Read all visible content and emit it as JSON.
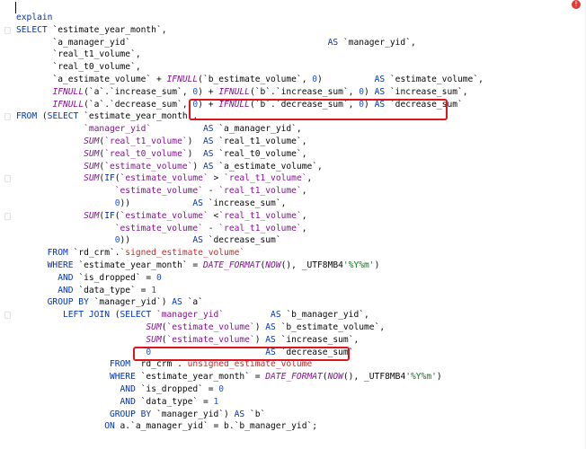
{
  "editor": {
    "status": {
      "warning_glyph": "!"
    },
    "lines": [
      [
        [
          "kw",
          "explain"
        ]
      ],
      [
        [
          "kw",
          "SELECT "
        ],
        [
          "ident",
          "`estimate_year_month`,"
        ]
      ],
      [
        [
          "ident",
          "       `a_manager_yid`                                      "
        ],
        [
          "kw",
          "AS "
        ],
        [
          "ident",
          "`manager_yid`,"
        ]
      ],
      [
        [
          "ident",
          "       `real_t1_volume`,"
        ]
      ],
      [
        [
          "ident",
          "       `real_t0_volume`,"
        ]
      ],
      [
        [
          "ident",
          "       `a_estimate_volume` + "
        ],
        [
          "fn",
          "IFNULL"
        ],
        [
          "ident",
          "(`b_estimate_volume`, "
        ],
        [
          "num",
          "0"
        ],
        [
          "ident",
          ")          "
        ],
        [
          "kw",
          "AS "
        ],
        [
          "ident",
          "`estimate_volume`,"
        ]
      ],
      [
        [
          "ident",
          "       "
        ],
        [
          "fn",
          "IFNULL"
        ],
        [
          "ident",
          "(`a`.`increase_sum`, "
        ],
        [
          "num",
          "0"
        ],
        [
          "ident",
          ") + "
        ],
        [
          "fn",
          "IFNULL"
        ],
        [
          "ident",
          "(`b`.`increase_sum`, "
        ],
        [
          "num",
          "0"
        ],
        [
          "ident",
          ") "
        ],
        [
          "kw",
          "AS "
        ],
        [
          "ident",
          "`increase_sum`,"
        ]
      ],
      [
        [
          "ident",
          "       "
        ],
        [
          "fn",
          "IFNULL"
        ],
        [
          "ident",
          "(`a`.`decrease_sum`, "
        ],
        [
          "num",
          "0"
        ],
        [
          "ident",
          ") + "
        ],
        [
          "fn",
          "IFNULL"
        ],
        [
          "ident",
          "(`b`.`decrease_sum`, "
        ],
        [
          "num",
          "0"
        ],
        [
          "ident",
          ") "
        ],
        [
          "kw",
          "AS "
        ],
        [
          "ident",
          "`decrease_sum`"
        ]
      ],
      [
        [
          "kw",
          "FROM "
        ],
        [
          "ident",
          "("
        ],
        [
          "kw",
          "SELECT "
        ],
        [
          "ident",
          "`estimate_year_month`,"
        ]
      ],
      [
        [
          "ident",
          "             "
        ],
        [
          "col",
          "`manager_yid`"
        ],
        [
          "ident",
          "          "
        ],
        [
          "kw",
          "AS "
        ],
        [
          "ident",
          "`a_manager_yid`,"
        ]
      ],
      [
        [
          "ident",
          "             "
        ],
        [
          "fn",
          "SUM"
        ],
        [
          "ident",
          "("
        ],
        [
          "col",
          "`real_t1_volume`"
        ],
        [
          "ident",
          ")  "
        ],
        [
          "kw",
          "AS "
        ],
        [
          "ident",
          "`real_t1_volume`,"
        ]
      ],
      [
        [
          "ident",
          "             "
        ],
        [
          "fn",
          "SUM"
        ],
        [
          "ident",
          "("
        ],
        [
          "col",
          "`real_t0_volume`"
        ],
        [
          "ident",
          ")  "
        ],
        [
          "kw",
          "AS "
        ],
        [
          "ident",
          "`real_t0_volume`,"
        ]
      ],
      [
        [
          "ident",
          "             "
        ],
        [
          "fn",
          "SUM"
        ],
        [
          "ident",
          "("
        ],
        [
          "col",
          "`estimate_volume`"
        ],
        [
          "ident",
          ") "
        ],
        [
          "kw",
          "AS "
        ],
        [
          "ident",
          "`a_estimate_volume`,"
        ]
      ],
      [
        [
          "ident",
          "             "
        ],
        [
          "fn",
          "SUM"
        ],
        [
          "ident",
          "("
        ],
        [
          "kw",
          "IF"
        ],
        [
          "ident",
          "("
        ],
        [
          "col",
          "`estimate_volume`"
        ],
        [
          "ident",
          " > "
        ],
        [
          "col",
          "`real_t1_volume`"
        ],
        [
          "ident",
          ","
        ]
      ],
      [
        [
          "ident",
          "                   "
        ],
        [
          "col",
          "`estimate_volume`"
        ],
        [
          "ident",
          " - "
        ],
        [
          "col",
          "`real_t1_volume`"
        ],
        [
          "ident",
          ","
        ]
      ],
      [
        [
          "ident",
          "                   "
        ],
        [
          "num",
          "0"
        ],
        [
          "ident",
          "))            "
        ],
        [
          "kw",
          "AS "
        ],
        [
          "ident",
          "`increase_sum`,"
        ]
      ],
      [
        [
          "ident",
          "             "
        ],
        [
          "fn",
          "SUM"
        ],
        [
          "ident",
          "("
        ],
        [
          "kw",
          "IF"
        ],
        [
          "ident",
          "("
        ],
        [
          "col",
          "`estimate_volume`"
        ],
        [
          "ident",
          " <"
        ],
        [
          "col",
          "`real_t1_volume`"
        ],
        [
          "ident",
          ","
        ]
      ],
      [
        [
          "ident",
          "                   "
        ],
        [
          "col",
          "`estimate_volume`"
        ],
        [
          "ident",
          " - "
        ],
        [
          "col",
          "`real_t1_volume`"
        ],
        [
          "ident",
          ","
        ]
      ],
      [
        [
          "ident",
          "                   "
        ],
        [
          "num",
          "0"
        ],
        [
          "ident",
          "))            "
        ],
        [
          "kw",
          "AS "
        ],
        [
          "ident",
          "`decrease_sum`"
        ]
      ],
      [
        [
          "ident",
          "      "
        ],
        [
          "kw",
          "FROM "
        ],
        [
          "ident",
          "`rd_crm`."
        ],
        [
          "red",
          "`signed_estimate_volume`"
        ]
      ],
      [
        [
          "ident",
          "      "
        ],
        [
          "kw",
          "WHERE "
        ],
        [
          "ident",
          "`estimate_year_month` = "
        ],
        [
          "fn",
          "DATE_FORMAT"
        ],
        [
          "ident",
          "("
        ],
        [
          "fn",
          "NOW"
        ],
        [
          "ident",
          "(), _UTF8MB4"
        ],
        [
          "str",
          "'%Y%m'"
        ],
        [
          "ident",
          ")"
        ]
      ],
      [
        [
          "ident",
          "        "
        ],
        [
          "kw",
          "AND "
        ],
        [
          "ident",
          "`is_dropped` = "
        ],
        [
          "num",
          "0"
        ]
      ],
      [
        [
          "ident",
          "        "
        ],
        [
          "kw",
          "AND "
        ],
        [
          "ident",
          "`data_type` = "
        ],
        [
          "num",
          "1"
        ]
      ],
      [
        [
          "ident",
          "      "
        ],
        [
          "kw",
          "GROUP BY "
        ],
        [
          "ident",
          "`manager_yid`) "
        ],
        [
          "kw",
          "AS "
        ],
        [
          "ident",
          "`a`"
        ]
      ],
      [
        [
          "ident",
          "         "
        ],
        [
          "kw",
          "LEFT JOIN "
        ],
        [
          "ident",
          "("
        ],
        [
          "kw",
          "SELECT "
        ],
        [
          "col",
          "`manager_yid`"
        ],
        [
          "ident",
          "         "
        ],
        [
          "kw",
          "AS "
        ],
        [
          "ident",
          "`b_manager_yid`,"
        ]
      ],
      [
        [
          "ident",
          "                         "
        ],
        [
          "fn",
          "SUM"
        ],
        [
          "ident",
          "("
        ],
        [
          "col",
          "`estimate_volume`"
        ],
        [
          "ident",
          ") "
        ],
        [
          "kw",
          "AS "
        ],
        [
          "ident",
          "`b_estimate_volume`,"
        ]
      ],
      [
        [
          "ident",
          "                         "
        ],
        [
          "fn",
          "SUM"
        ],
        [
          "ident",
          "("
        ],
        [
          "col",
          "`estimate_volume`"
        ],
        [
          "ident",
          ") "
        ],
        [
          "kw",
          "AS "
        ],
        [
          "ident",
          "`increase_sum`,"
        ]
      ],
      [
        [
          "ident",
          "                         "
        ],
        [
          "num",
          "0"
        ],
        [
          "ident",
          "                      "
        ],
        [
          "kw",
          "AS "
        ],
        [
          "ident",
          "`decrease_sum`"
        ]
      ],
      [
        [
          "ident",
          "                  "
        ],
        [
          "kw",
          "FROM "
        ],
        [
          "ident",
          "`rd_crm`."
        ],
        [
          "red",
          "`unsigned_estimate_volume`"
        ]
      ],
      [
        [
          "ident",
          "                  "
        ],
        [
          "kw",
          "WHERE "
        ],
        [
          "ident",
          "`estimate_year_month` = "
        ],
        [
          "fn",
          "DATE_FORMAT"
        ],
        [
          "ident",
          "("
        ],
        [
          "fn",
          "NOW"
        ],
        [
          "ident",
          "(), _UTF8MB4"
        ],
        [
          "str",
          "'%Y%m'"
        ],
        [
          "ident",
          ")"
        ]
      ],
      [
        [
          "ident",
          "                    "
        ],
        [
          "kw",
          "AND "
        ],
        [
          "ident",
          "`is_dropped` = "
        ],
        [
          "num",
          "0"
        ]
      ],
      [
        [
          "ident",
          "                    "
        ],
        [
          "kw",
          "AND "
        ],
        [
          "ident",
          "`data_type` = "
        ],
        [
          "num",
          "1"
        ]
      ],
      [
        [
          "ident",
          "                  "
        ],
        [
          "kw",
          "GROUP BY "
        ],
        [
          "ident",
          "`manager_yid`) "
        ],
        [
          "kw",
          "AS "
        ],
        [
          "ident",
          "`b`"
        ]
      ],
      [
        [
          "ident",
          "                 "
        ],
        [
          "kw",
          "ON "
        ],
        [
          "ident",
          "a.`a_manager_yid` = b.`b_manager_yid`;"
        ]
      ]
    ]
  }
}
